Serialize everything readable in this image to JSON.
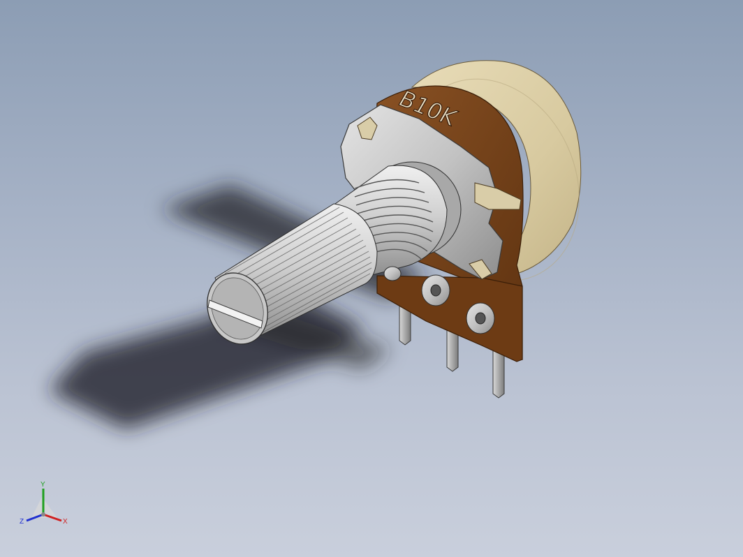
{
  "viewport": {
    "background_top": "#8c9db4",
    "background_bottom": "#c9cfdc"
  },
  "part": {
    "marking": "B10K",
    "body_color": "#ddd0aa",
    "substrate_color": "#7a4518",
    "metal_color": "#bdbdbd"
  },
  "triad": {
    "x_label": "X",
    "y_label": "Y",
    "z_label": "Z",
    "x_color": "#d02020",
    "y_color": "#20a020",
    "z_color": "#2030d0"
  }
}
